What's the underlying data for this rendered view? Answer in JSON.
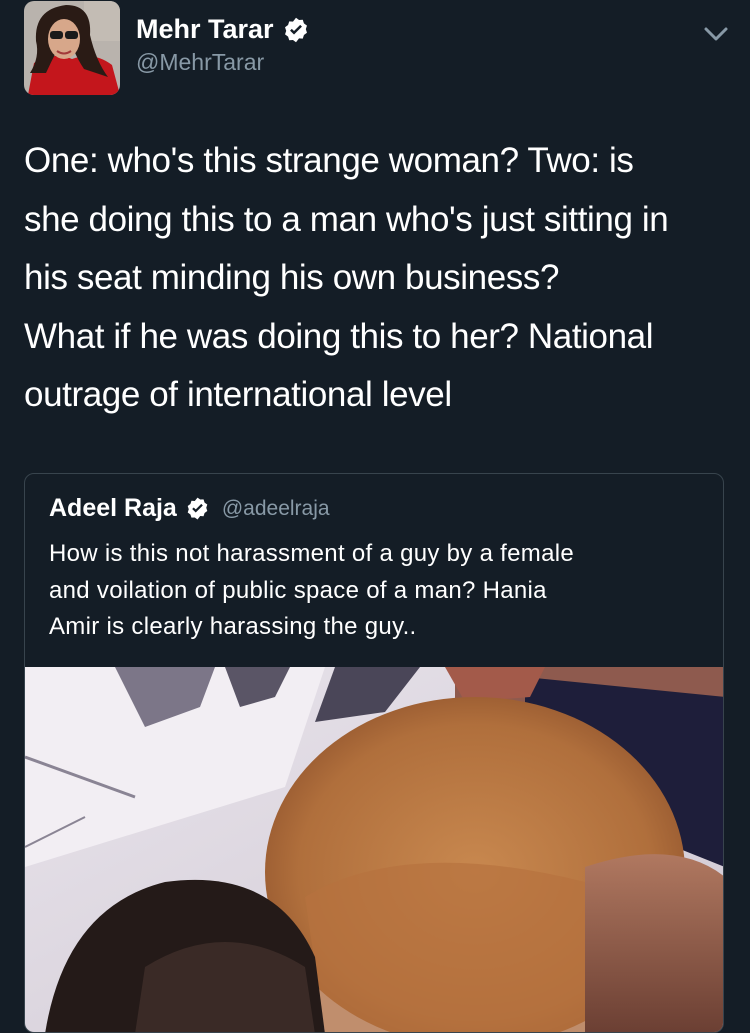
{
  "tweet": {
    "author_name": "Mehr Tarar",
    "author_handle": "@MehrTarar",
    "text_lines": [
      "One: who's this strange woman? Two: is",
      "she doing this to a man who's just sitting in",
      "his seat minding his own business?",
      "What if he was doing this to her? National",
      "outrage of international level"
    ]
  },
  "quoted_tweet": {
    "author_name": "Adeel Raja",
    "author_handle": "@adeelraja",
    "text_lines": [
      "How is this not harassment of a guy by a female",
      "and voilation of public space of a man? Hania",
      "Amir is clearly harassing the guy.."
    ]
  },
  "icons": {
    "verified": "verified-badge-icon",
    "menu": "chevron-down-icon"
  },
  "colors": {
    "background": "#141d26",
    "secondary_text": "#8899a6",
    "border": "#38444d"
  }
}
